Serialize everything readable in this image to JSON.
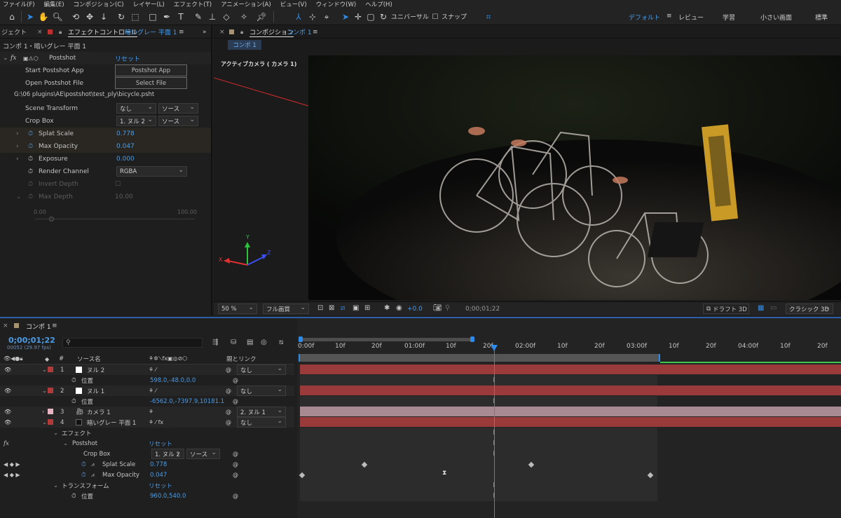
{
  "menu": [
    "ファイル(F)",
    "編集(E)",
    "コンポジション(C)",
    "レイヤー(L)",
    "エフェクト(T)",
    "アニメーション(A)",
    "ビュー(V)",
    "ウィンドウ(W)",
    "ヘルプ(H)"
  ],
  "toolbar": {
    "universal_label": "ユニバーサル",
    "snap_label": "スナップ",
    "workspaces": [
      "デフォルト",
      "レビュー",
      "学習",
      "小さい画面",
      "標準"
    ],
    "active_workspace": "デフォルト"
  },
  "effect_panel": {
    "tab_project": "ジェクト",
    "tab_label": "エフェクトコントロール",
    "tab_layer": "暗いグレー 平面 1",
    "breadcrumb": "コンポ 1・暗いグレー 平面 1",
    "effect_name": "Postshot",
    "reset_label": "リセット",
    "start_app_label": "Start Postshot App",
    "start_app_button": "Postshot App",
    "open_file_label": "Open Postshot File",
    "open_file_button": "Select File",
    "file_path": "G:\\06 plugins\\AE\\postshot\\test_ply\\bicycle.psht",
    "scene_transform_label": "Scene Transform",
    "scene_transform_value": "なし",
    "scene_transform_source": "ソース",
    "crop_box_label": "Crop Box",
    "crop_box_value": "1. ヌル 2",
    "crop_box_source": "ソース",
    "splat_scale_label": "Splat Scale",
    "splat_scale_value": "0.778",
    "max_opacity_label": "Max Opacity",
    "max_opacity_value": "0.047",
    "exposure_label": "Exposure",
    "exposure_value": "0.000",
    "render_channel_label": "Render Channel",
    "render_channel_value": "RGBA",
    "invert_depth_label": "Invert Depth",
    "max_depth_label": "Max Depth",
    "max_depth_value": "10.00",
    "slider_min": "0.00",
    "slider_max": "100.00"
  },
  "comp_panel": {
    "tab_label": "コンポジション",
    "tab_comp": "コンポ 1",
    "sub_tab": "コンポ 1",
    "camera_label": "アクティブカメラ ( カメラ 1)",
    "axis_x": "X",
    "axis_y": "Y",
    "axis_z": "Z",
    "zoom": "50 %",
    "quality": "フル画質",
    "exposure": "+0.0",
    "timecode": "0;00;01;22",
    "draft_label": "ドラフト 3D",
    "renderer": "クラシック 3D"
  },
  "timeline": {
    "tab_label": "コンポ 1",
    "timecode": "0;00;01;22",
    "frames_fps": "00052 (29.97 fps)",
    "search_placeholder": "",
    "col_source": "ソース名",
    "col_num": "#",
    "col_parent": "親とリンク",
    "ruler": [
      "0:00f",
      "10f",
      "20f",
      "01:00f",
      "10f",
      "20f",
      "02:00f",
      "10f",
      "20f",
      "03:00f",
      "10f",
      "20f",
      "04:00f",
      "10f",
      "20f"
    ],
    "layers": [
      {
        "num": "1",
        "name": "ヌル 2",
        "parent": "なし",
        "prop": "位置",
        "prop_value": "598.0,-48.0,0.0"
      },
      {
        "num": "2",
        "name": "ヌル 1",
        "parent": "なし",
        "prop": "位置",
        "prop_value": "-6562.0,-7397.9,10181.1"
      },
      {
        "num": "3",
        "name": "カメラ 1",
        "parent": "2. ヌル 1"
      },
      {
        "num": "4",
        "name": "暗いグレー 平面 1",
        "parent": "なし"
      }
    ],
    "effects_label": "エフェクト",
    "postshot_label": "Postshot",
    "reset_label": "リセット",
    "crop_box_label": "Crop Box",
    "crop_box_value": "1. ヌル 2",
    "crop_box_source": "ソース",
    "splat_scale_label": "Splat Scale",
    "splat_scale_value": "0.778",
    "max_opacity_label": "Max Opacity",
    "max_opacity_value": "0.047",
    "transform_label": "トランスフォーム",
    "position_label": "位置",
    "position_value": "960.0,540.0"
  },
  "colors": {
    "accent": "#2d8ceb",
    "red_label": "#b33a3a",
    "pink_label": "#e8b4c4",
    "track_red": "#9b3a3a",
    "track_pink": "#a88a92"
  }
}
